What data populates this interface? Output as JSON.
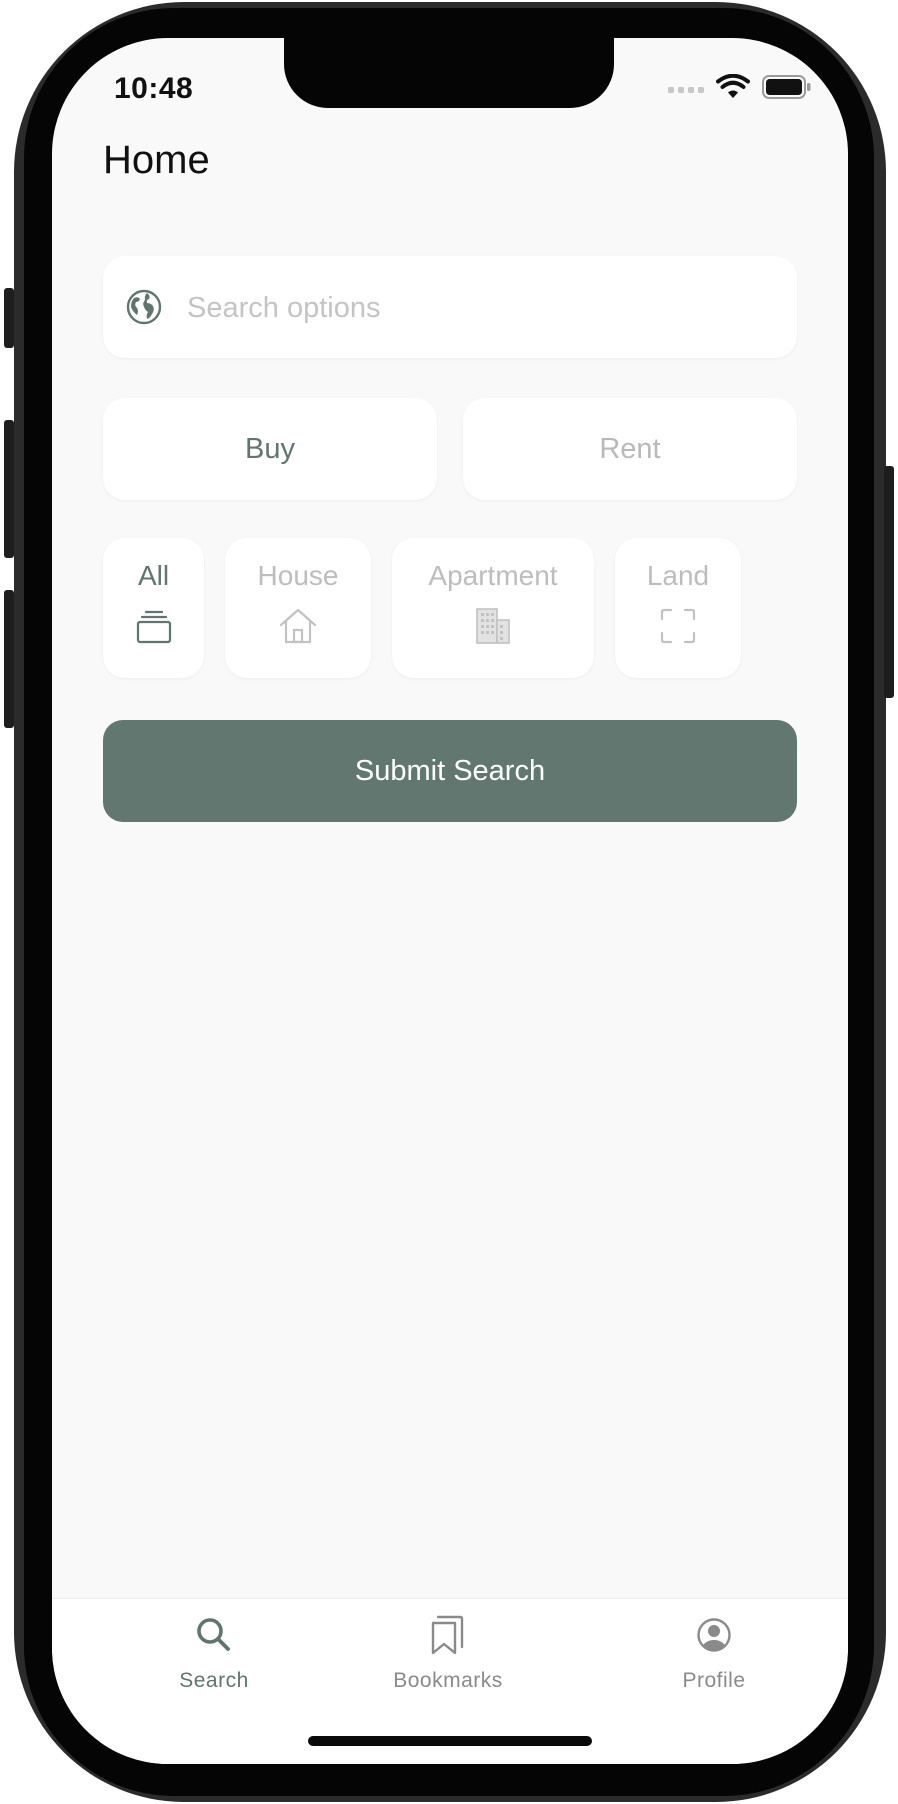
{
  "status_bar": {
    "time": "10:48"
  },
  "header": {
    "title": "Home"
  },
  "search": {
    "placeholder": "Search options",
    "value": "",
    "icon": "globe-icon"
  },
  "listing_mode": {
    "options": [
      {
        "label": "Buy",
        "selected": true
      },
      {
        "label": "Rent",
        "selected": false
      }
    ]
  },
  "property_types": [
    {
      "label": "All",
      "icon": "stack-icon",
      "selected": true
    },
    {
      "label": "House",
      "icon": "house-icon",
      "selected": false
    },
    {
      "label": "Apartment",
      "icon": "building-icon",
      "selected": false
    },
    {
      "label": "Land",
      "icon": "land-frame-icon",
      "selected": false
    }
  ],
  "submit": {
    "label": "Submit Search"
  },
  "tab_bar": {
    "items": [
      {
        "label": "Search",
        "icon": "search-icon",
        "active": true
      },
      {
        "label": "Bookmarks",
        "icon": "bookmarks-icon",
        "active": false
      },
      {
        "label": "Profile",
        "icon": "profile-icon",
        "active": false
      }
    ]
  },
  "colors": {
    "accent": "#617770",
    "background": "#f9f9f9",
    "card": "#ffffff",
    "inactive_text": "#bdbdbd"
  }
}
